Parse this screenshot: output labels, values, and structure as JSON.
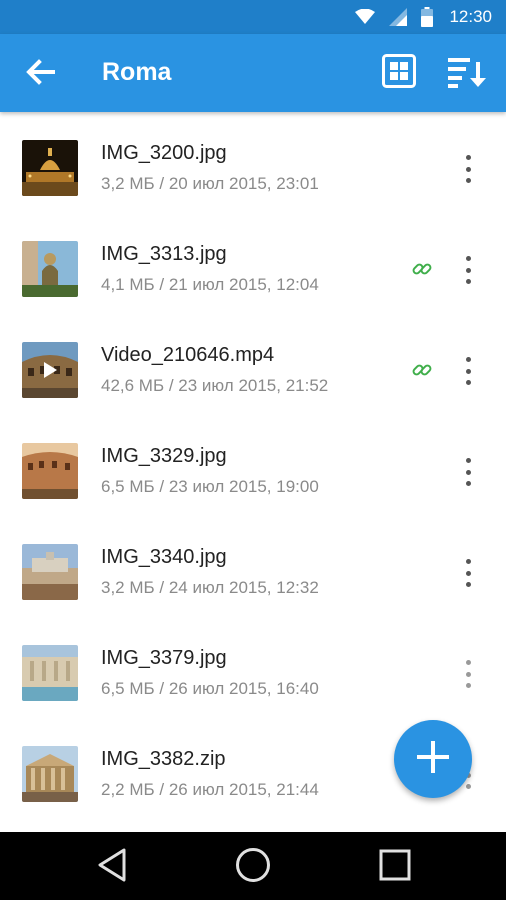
{
  "status_bar": {
    "time": "12:30",
    "icons": [
      "wifi-icon",
      "signal-icon",
      "battery-icon"
    ]
  },
  "app_bar": {
    "title": "Roma",
    "back_icon": "arrow-back-icon",
    "actions": [
      "grid-view-icon",
      "sort-icon"
    ]
  },
  "files": [
    {
      "name": "IMG_3200.jpg",
      "meta": "3,2 МБ / 20 июл 2015, 23:01",
      "shared": false,
      "type": "image"
    },
    {
      "name": "IMG_3313.jpg",
      "meta": "4,1 МБ / 21 июл 2015, 12:04",
      "shared": true,
      "type": "image"
    },
    {
      "name": "Video_210646.mp4",
      "meta": "42,6 МБ / 23 июл 2015, 21:52",
      "shared": true,
      "type": "video"
    },
    {
      "name": "IMG_3329.jpg",
      "meta": "6,5 МБ / 23 июл 2015, 19:00",
      "shared": false,
      "type": "image"
    },
    {
      "name": "IMG_3340.jpg",
      "meta": "3,2 МБ / 24 июл 2015, 12:32",
      "shared": false,
      "type": "image"
    },
    {
      "name": "IMG_3379.jpg",
      "meta": "6,5 МБ / 26 июл 2015, 16:40",
      "shared": false,
      "type": "image"
    },
    {
      "name": "IMG_3382.zip",
      "meta": "2,2 МБ / 26 июл 2015, 21:44",
      "shared": false,
      "type": "image"
    }
  ],
  "fab": {
    "icon": "plus-icon"
  },
  "nav_bar": {
    "icons": [
      "back-triangle-icon",
      "home-circle-icon",
      "recents-square-icon"
    ]
  },
  "colors": {
    "status_bar": "#1f7fc9",
    "app_bar": "#2a93e2",
    "accent": "#2a93e2",
    "link": "#3fae4a",
    "meta_text": "#8a8a8a"
  }
}
